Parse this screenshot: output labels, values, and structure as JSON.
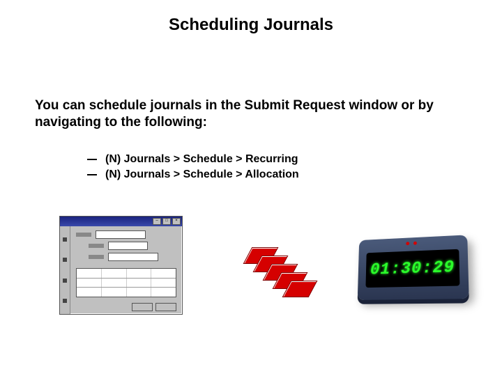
{
  "title": "Scheduling Journals",
  "intro": "You can schedule journals in the Submit Request window or by navigating to the following:",
  "nav_paths": [
    "(N) Journals > Schedule > Recurring",
    "(N) Journals > Schedule > Allocation"
  ],
  "clock": {
    "time": "01:30:29"
  }
}
